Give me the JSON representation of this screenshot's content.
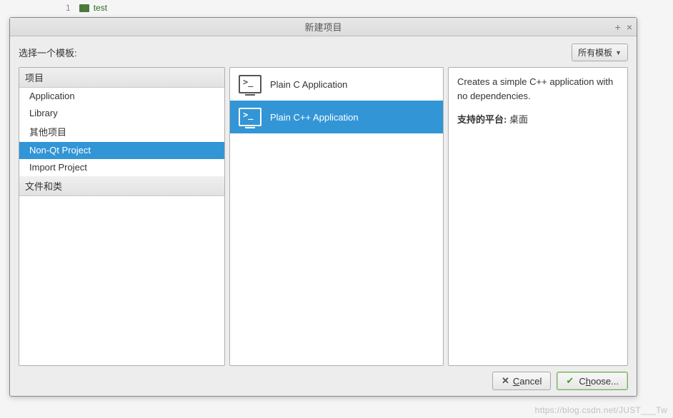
{
  "background": {
    "line_number": "1",
    "folder_label": "test"
  },
  "dialog": {
    "title": "新建项目",
    "choose_template_label": "选择一个模板:",
    "filter_label": "所有模板",
    "categories": {
      "groups": [
        {
          "header": "项目",
          "items": [
            "Application",
            "Library",
            "其他项目",
            "Non-Qt Project",
            "Import Project"
          ]
        },
        {
          "header": "文件和类",
          "items": []
        }
      ],
      "selected": "Non-Qt Project"
    },
    "templates": {
      "items": [
        "Plain C Application",
        "Plain C++ Application"
      ],
      "selected": "Plain C++ Application"
    },
    "description": {
      "text": "Creates a simple C++ application with no dependencies.",
      "platform_label": "支持的平台",
      "platform_value": "桌面"
    },
    "buttons": {
      "cancel": "Cancel",
      "choose": "Choose..."
    }
  },
  "watermark": "https://blog.csdn.net/JUST___Tw"
}
